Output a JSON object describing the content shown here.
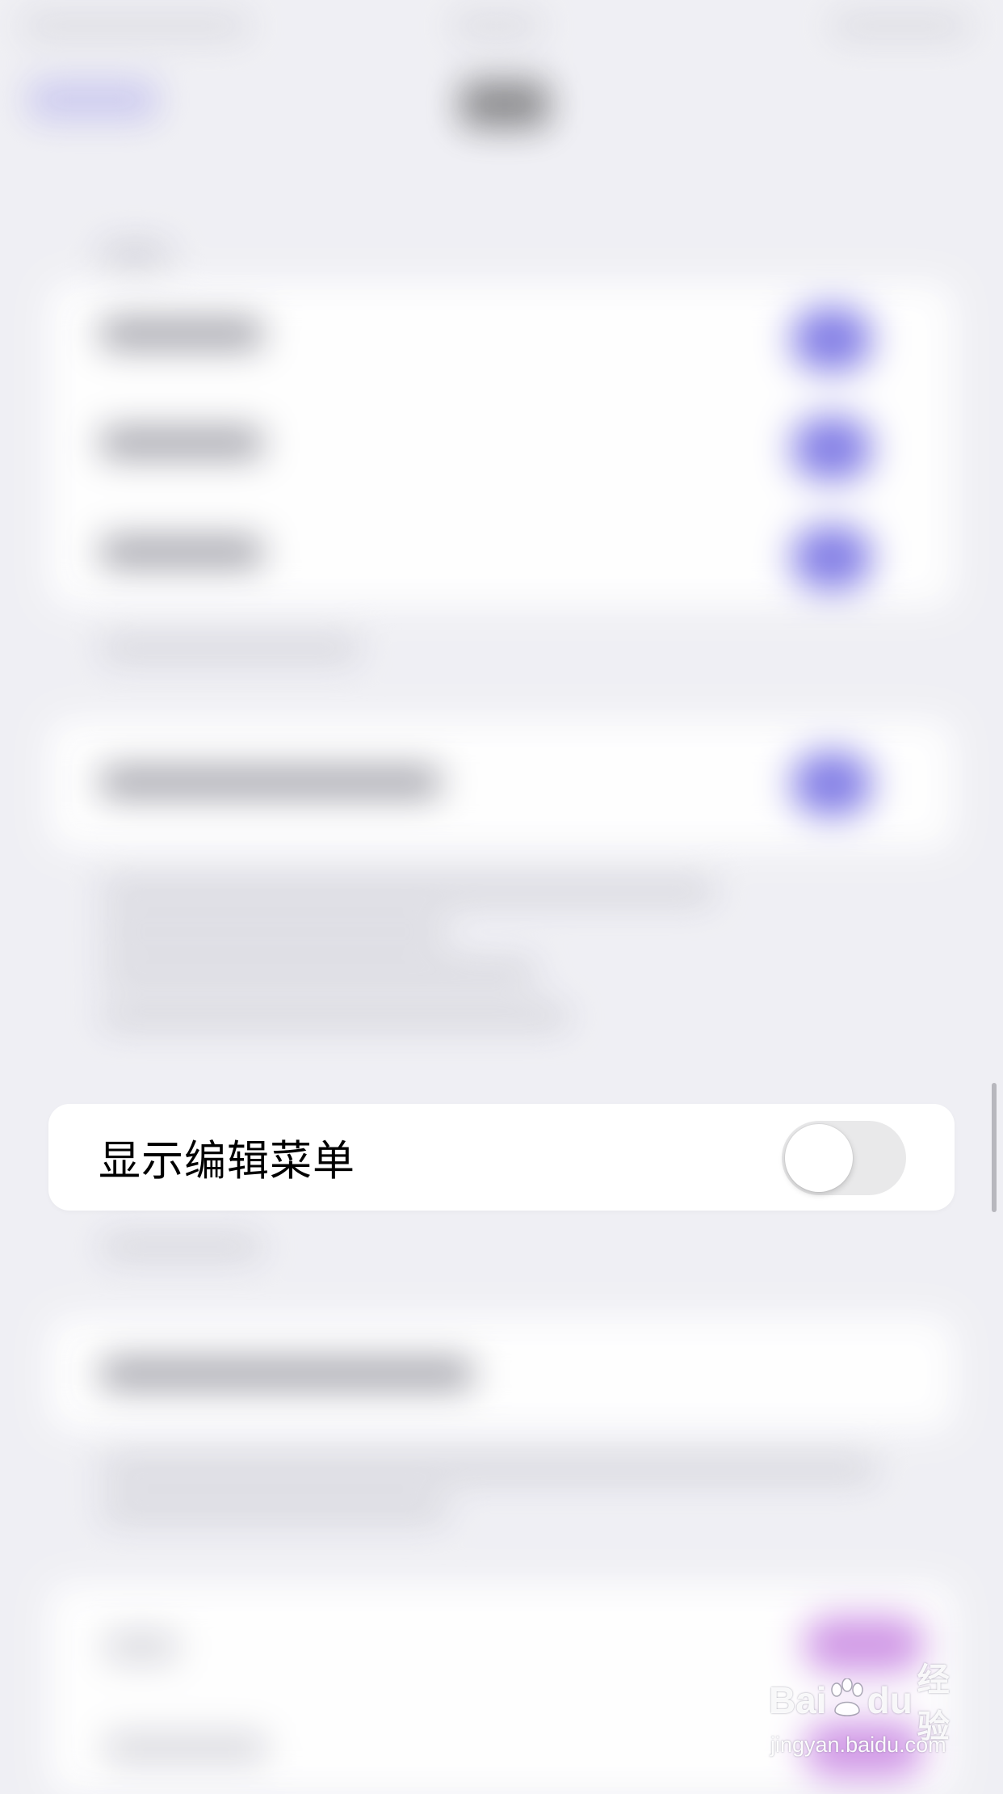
{
  "setting": {
    "label": "显示编辑菜单",
    "enabled": false
  },
  "watermark": {
    "logo_bai": "Bai",
    "logo_du": "du",
    "logo_cn": "经验",
    "url": "jingyan.baidu.com"
  },
  "colors": {
    "background": "#efeff4",
    "card": "#ffffff",
    "toggle_off_track": "#e9e9ea",
    "toggle_on_blurred": "#7f7ae6",
    "accent_purple_blurred": "#cf94e6"
  }
}
